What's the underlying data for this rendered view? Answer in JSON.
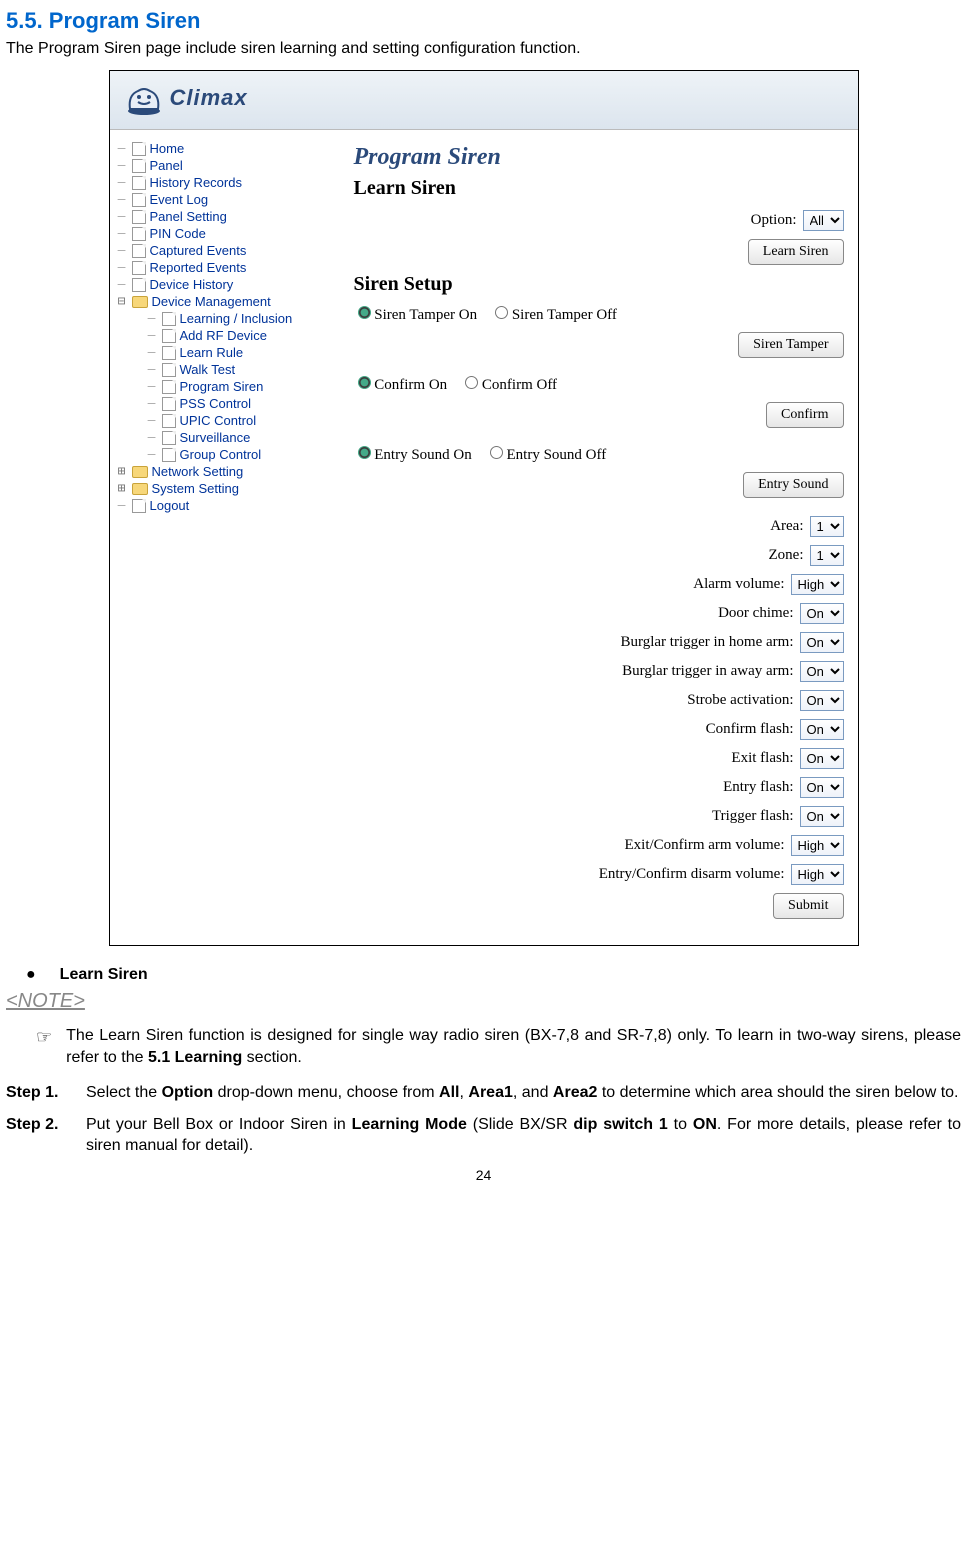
{
  "heading": "5.5. Program Siren",
  "intro": "The Program Siren page include siren learning and setting configuration function.",
  "logo_text": "Climax",
  "tree": {
    "items": [
      {
        "label": "Home"
      },
      {
        "label": "Panel"
      },
      {
        "label": "History Records"
      },
      {
        "label": "Event Log"
      },
      {
        "label": "Panel Setting"
      },
      {
        "label": "PIN Code"
      },
      {
        "label": "Captured Events"
      },
      {
        "label": "Reported Events"
      },
      {
        "label": "Device History"
      }
    ],
    "device_mgmt": {
      "label": "Device Management",
      "children": [
        {
          "label": "Learning / Inclusion"
        },
        {
          "label": "Add RF Device"
        },
        {
          "label": "Learn Rule"
        },
        {
          "label": "Walk Test"
        },
        {
          "label": "Program Siren"
        },
        {
          "label": "PSS Control"
        },
        {
          "label": "UPIC Control"
        },
        {
          "label": "Surveillance"
        },
        {
          "label": "Group Control"
        }
      ]
    },
    "network": {
      "label": "Network Setting"
    },
    "system": {
      "label": "System Setting"
    },
    "logout": {
      "label": "Logout"
    }
  },
  "panel": {
    "title": "Program Siren",
    "learn_siren_hdr": "Learn Siren",
    "option_label": "Option:",
    "option_value": "All",
    "learn_btn": "Learn Siren",
    "siren_setup_hdr": "Siren Setup",
    "tamper_on": "Siren Tamper On",
    "tamper_off": "Siren Tamper Off",
    "tamper_btn": "Siren Tamper",
    "confirm_on": "Confirm On",
    "confirm_off": "Confirm Off",
    "confirm_btn": "Confirm",
    "entry_on": "Entry Sound On",
    "entry_off": "Entry Sound Off",
    "entry_btn": "Entry Sound",
    "rows": [
      {
        "label": "Area:",
        "value": "1"
      },
      {
        "label": "Zone:",
        "value": "1"
      },
      {
        "label": "Alarm volume:",
        "value": "High"
      },
      {
        "label": "Door chime:",
        "value": "On"
      },
      {
        "label": "Burglar trigger in home arm:",
        "value": "On"
      },
      {
        "label": "Burglar trigger in away arm:",
        "value": "On"
      },
      {
        "label": "Strobe activation:",
        "value": "On"
      },
      {
        "label": "Confirm flash:",
        "value": "On"
      },
      {
        "label": "Exit flash:",
        "value": "On"
      },
      {
        "label": "Entry flash:",
        "value": "On"
      },
      {
        "label": "Trigger flash:",
        "value": "On"
      },
      {
        "label": "Exit/Confirm arm volume:",
        "value": "High"
      },
      {
        "label": "Entry/Confirm disarm volume:",
        "value": "High"
      }
    ],
    "submit_btn": "Submit"
  },
  "after": {
    "bullet": "Learn Siren",
    "note_hdr": "<NOTE>",
    "note_body_1": "The Learn Siren function is designed for single way radio siren (BX-7,8 and SR-7,8) only. To learn in two-way sirens, please refer to the ",
    "note_body_bold_1": "5.1 Learning",
    "note_body_2": " section.",
    "step1_label": "Step 1.",
    "step1_a": "Select the ",
    "step1_b": "Option",
    "step1_c": " drop-down menu, choose from ",
    "step1_d": "All",
    "step1_e": ", ",
    "step1_f": "Area1",
    "step1_g": ", and ",
    "step1_h": "Area2",
    "step1_i": " to determine which area should the siren below to.",
    "step2_label": "Step 2.",
    "step2_a": "Put your Bell Box or Indoor Siren in ",
    "step2_b": "Learning Mode",
    "step2_c": " (Slide BX/SR ",
    "step2_d": "dip switch 1",
    "step2_e": " to ",
    "step2_f": "ON",
    "step2_g": ". For more details, please refer to siren manual for detail).",
    "page_number": "24"
  }
}
